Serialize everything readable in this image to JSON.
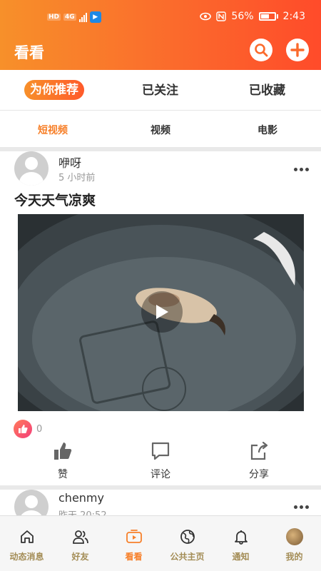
{
  "status_bar": {
    "network_badge": "HD",
    "network_type": "4G",
    "battery": "56%",
    "time": "2:43"
  },
  "header": {
    "title": "看看",
    "search_icon": "search-icon",
    "add_icon": "plus-icon"
  },
  "tabs_primary": [
    {
      "label": "为你推荐",
      "active": true
    },
    {
      "label": "已关注",
      "active": false
    },
    {
      "label": "已收藏",
      "active": false
    }
  ],
  "tabs_secondary": [
    {
      "label": "短视频",
      "active": true
    },
    {
      "label": "视频",
      "active": false
    },
    {
      "label": "电影",
      "active": false
    }
  ],
  "posts": [
    {
      "username": "咿呀",
      "time": "5 小时前",
      "title": "今天天气凉爽",
      "like_count": "0",
      "actions": [
        "赞",
        "评论",
        "分享"
      ]
    },
    {
      "username": "chenmy",
      "time": "昨天 20:52"
    }
  ],
  "bottom_nav": [
    {
      "label": "动态消息",
      "icon": "home-icon",
      "active": false
    },
    {
      "label": "好友",
      "icon": "friends-icon",
      "active": false
    },
    {
      "label": "看看",
      "icon": "video-play-icon",
      "active": true
    },
    {
      "label": "公共主页",
      "icon": "globe-icon",
      "active": false
    },
    {
      "label": "通知",
      "icon": "bell-icon",
      "active": false
    },
    {
      "label": "我的",
      "icon": "avatar-icon",
      "active": false
    }
  ],
  "colors": {
    "accent": "#f7802a",
    "header_gradient_start": "#f7902a",
    "header_gradient_end": "#ff4b2a",
    "nav_inactive": "#a38c55"
  }
}
